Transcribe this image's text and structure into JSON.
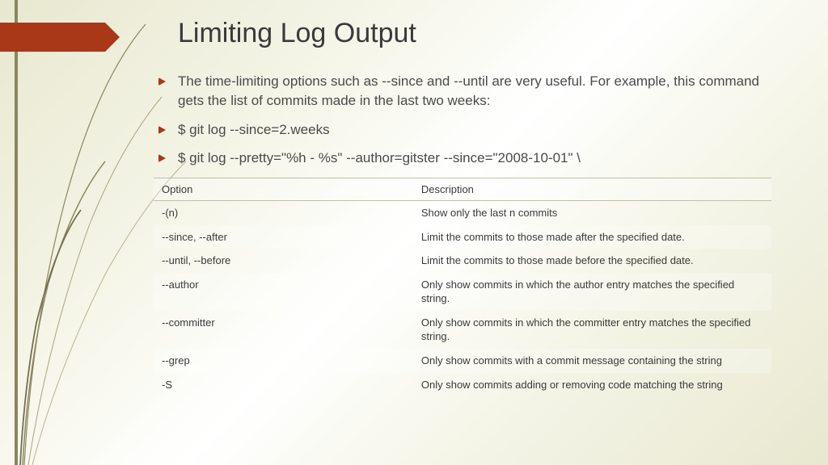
{
  "title": "Limiting Log Output",
  "bullets": [
    "The time-limiting options such as --since and --until are very useful. For example, this command gets the list of commits made in the last two weeks:",
    "$ git log --since=2.weeks",
    "$ git log --pretty=\"%h - %s\" --author=gitster --since=\"2008-10-01\" \\"
  ],
  "table": {
    "headers": [
      "Option",
      "Description"
    ],
    "rows": [
      {
        "option": "-(n)",
        "description": "Show only the last n commits"
      },
      {
        "option": "--since, --after",
        "description": "Limit the commits to those made after the specified date."
      },
      {
        "option": "--until, --before",
        "description": "Limit the commits to those made before the specified date."
      },
      {
        "option": "--author",
        "description": "Only show commits in which the author entry matches the specified string."
      },
      {
        "option": "--committer",
        "description": "Only show commits in which the committer entry matches the specified string."
      },
      {
        "option": "--grep",
        "description": "Only show commits with a commit message containing the string"
      },
      {
        "option": "-S",
        "description": "Only show commits adding or removing code matching the string"
      }
    ]
  }
}
